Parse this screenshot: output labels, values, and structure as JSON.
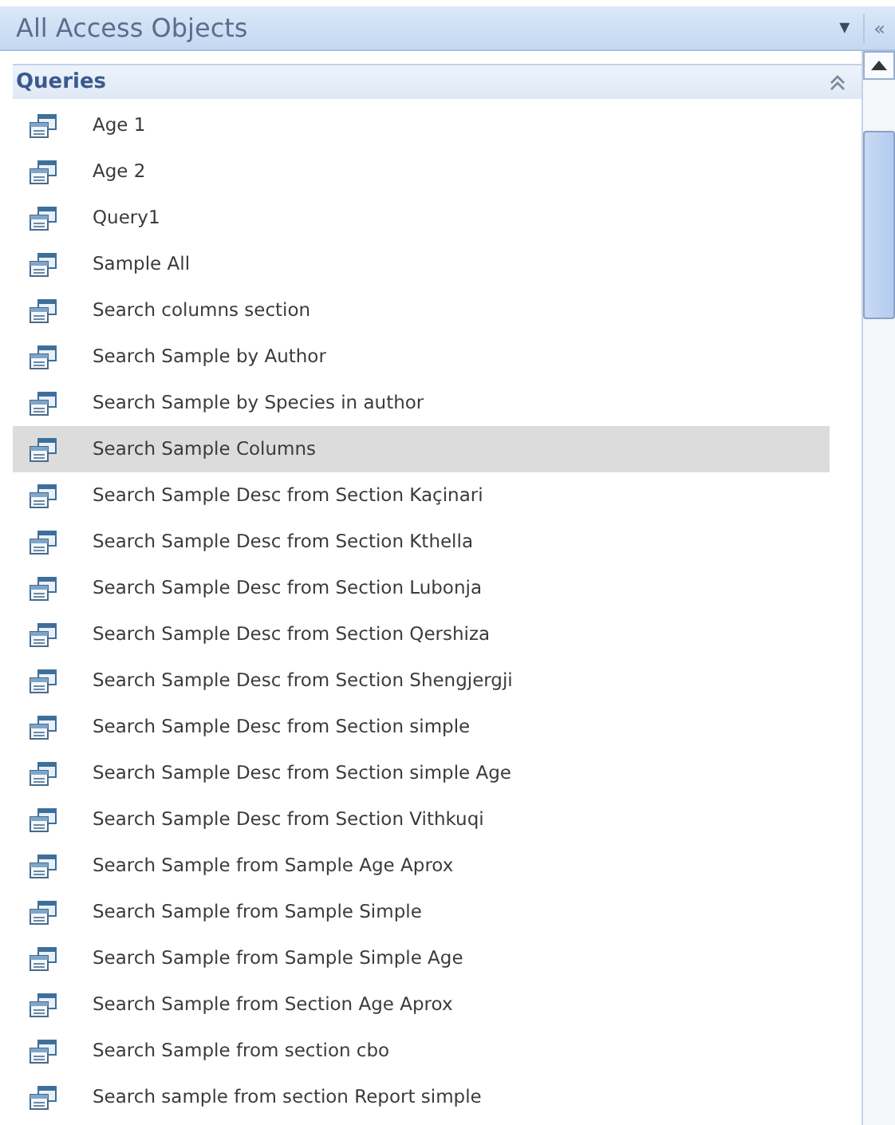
{
  "pane": {
    "title": "All Access Objects",
    "dropdown": "▾",
    "collapse": "«"
  },
  "group": {
    "title": "Queries",
    "expanded": true
  },
  "items": [
    {
      "label": "Age 1",
      "selected": false
    },
    {
      "label": "Age 2",
      "selected": false
    },
    {
      "label": "Query1",
      "selected": false
    },
    {
      "label": "Sample All",
      "selected": false
    },
    {
      "label": "Search columns section",
      "selected": false
    },
    {
      "label": "Search Sample by Author",
      "selected": false
    },
    {
      "label": "Search Sample by Species in author",
      "selected": false
    },
    {
      "label": "Search Sample Columns",
      "selected": true
    },
    {
      "label": "Search Sample Desc from Section Kaçinari",
      "selected": false
    },
    {
      "label": "Search Sample Desc from Section Kthella",
      "selected": false
    },
    {
      "label": "Search Sample Desc from Section Lubonja",
      "selected": false
    },
    {
      "label": "Search Sample Desc from Section Qershiza",
      "selected": false
    },
    {
      "label": "Search Sample Desc from Section Shengjergji",
      "selected": false
    },
    {
      "label": "Search Sample Desc from Section simple",
      "selected": false
    },
    {
      "label": "Search Sample Desc from Section simple Age",
      "selected": false
    },
    {
      "label": "Search Sample Desc from Section Vithkuqi",
      "selected": false
    },
    {
      "label": "Search Sample from Sample Age Aprox",
      "selected": false
    },
    {
      "label": "Search Sample from Sample Simple",
      "selected": false
    },
    {
      "label": "Search Sample from Sample Simple Age",
      "selected": false
    },
    {
      "label": "Search Sample from Section Age Aprox",
      "selected": false
    },
    {
      "label": "Search Sample from section cbo",
      "selected": false
    },
    {
      "label": "Search sample from section Report simple",
      "selected": false
    }
  ]
}
